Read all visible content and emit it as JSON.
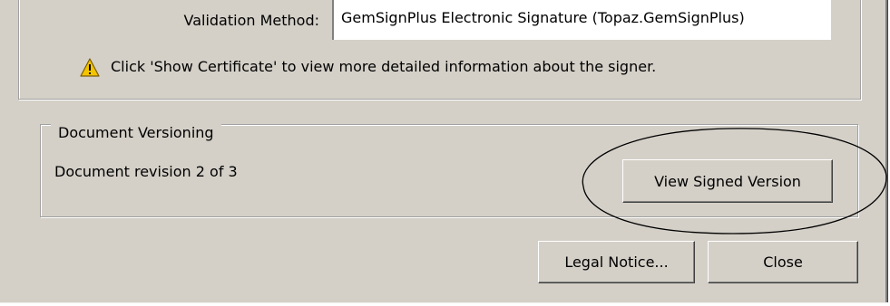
{
  "signature": {
    "validation_method_label": "Validation Method:",
    "validation_method_value": "GemSignPlus Electronic Signature  (Topaz.GemSignPlus)",
    "warning_icon": "warning-triangle-icon",
    "warning_text": "Click 'Show Certificate' to view more detailed information about the signer."
  },
  "versioning": {
    "legend": "Document Versioning",
    "revision_text": "Document revision 2 of 3",
    "view_signed_button": "View Signed Version"
  },
  "footer": {
    "legal_notice_button": "Legal Notice...",
    "close_button": "Close"
  },
  "colors": {
    "dialog_background": "#d4d0c8",
    "warning_yellow": "#f5c400",
    "annotation_ellipse": "#000000"
  }
}
